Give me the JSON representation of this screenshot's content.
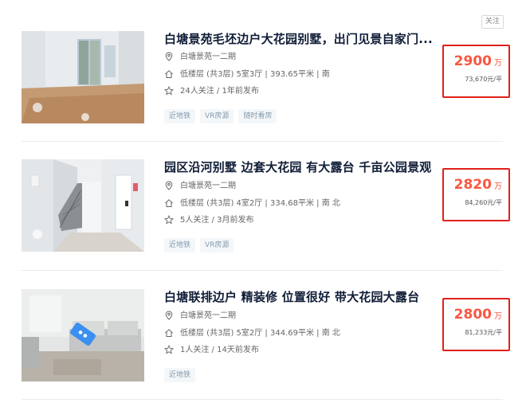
{
  "follow_label": "关注",
  "listings": [
    {
      "title": "白塘景苑毛坯边户大花园别墅，出门见景自家门...",
      "community": "白塘景苑一二期",
      "house_info": "低楼层 (共3层) 5室3厅 | 393.65平米 | 南",
      "follow_info": "24人关注 / 1年前发布",
      "tags": [
        "近地铁",
        "VR房源",
        "随时看房"
      ],
      "total_price": "2900",
      "price_unit": "万",
      "unit_price": "73,670元/平"
    },
    {
      "title": "园区沿河别墅 边套大花园 有大露台 千亩公园景观",
      "community": "白塘景苑一二期",
      "house_info": "低楼层 (共3层) 4室2厅 | 334.68平米 | 南 北",
      "follow_info": "5人关注 / 3月前发布",
      "tags": [
        "近地铁",
        "VR房源"
      ],
      "total_price": "2820",
      "price_unit": "万",
      "unit_price": "84,260元/平"
    },
    {
      "title": "白塘联排边户 精装修 位置很好 带大花园大露台",
      "community": "白塘景苑一二期",
      "house_info": "低楼层 (共3层) 5室2厅 | 344.69平米 | 南 北",
      "follow_info": "1人关注 / 14天前发布",
      "tags": [
        "近地铁"
      ],
      "total_price": "2800",
      "price_unit": "万",
      "unit_price": "81,233元/平"
    }
  ],
  "colors": {
    "price": "#fa5741",
    "highlight_box": "#e0211a",
    "title": "#101d37",
    "tag_text": "#849aae",
    "tag_bg": "#f4f7f9"
  },
  "icons": {
    "community": "location-pin-icon",
    "house_info": "house-icon",
    "follow_info": "star-icon",
    "vr_badge": "vr-3d-icon"
  }
}
